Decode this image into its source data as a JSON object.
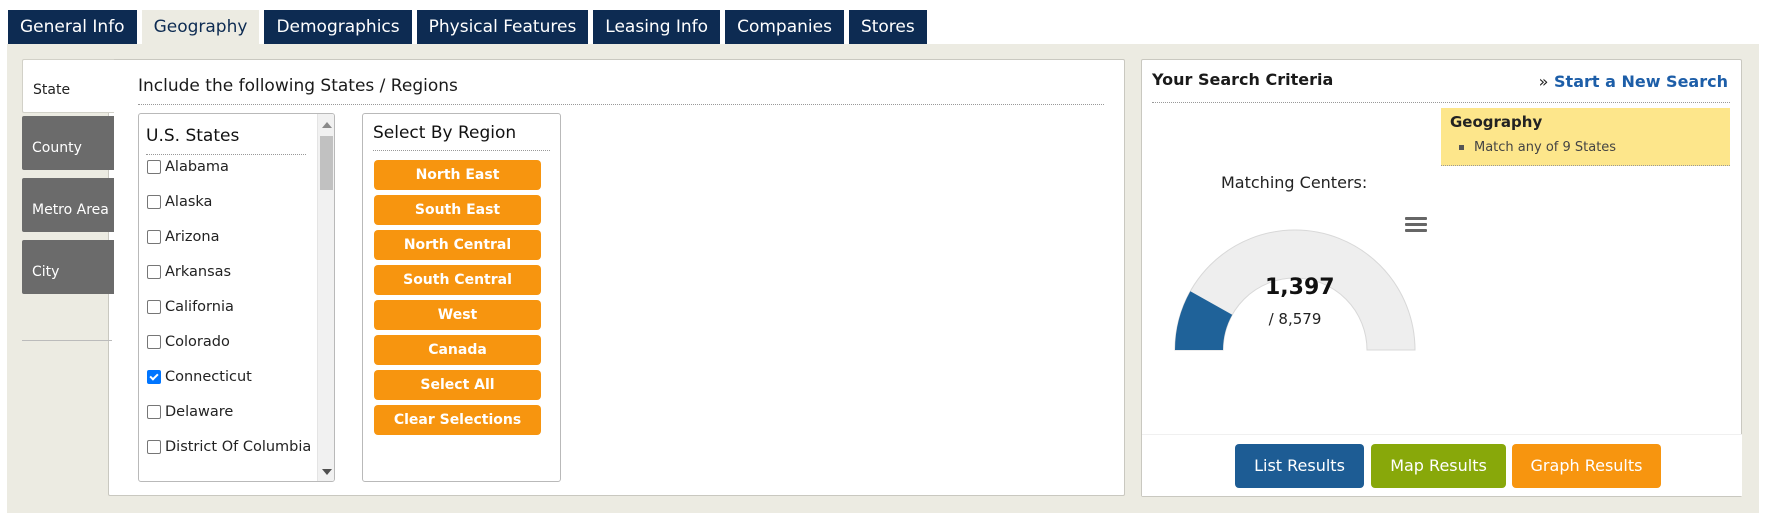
{
  "tabs": [
    "General Info",
    "Geography",
    "Demographics",
    "Physical Features",
    "Leasing Info",
    "Companies",
    "Stores"
  ],
  "active_tab": "Geography",
  "side_tabs": [
    "State",
    "County",
    "Metro Area",
    "City"
  ],
  "active_side_tab": "State",
  "section_title": "Include the following States / Regions",
  "states": {
    "heading": "U.S. States",
    "items": [
      {
        "label": "Alabama",
        "checked": false
      },
      {
        "label": "Alaska",
        "checked": false
      },
      {
        "label": "Arizona",
        "checked": false
      },
      {
        "label": "Arkansas",
        "checked": false
      },
      {
        "label": "California",
        "checked": false
      },
      {
        "label": "Colorado",
        "checked": false
      },
      {
        "label": "Connecticut",
        "checked": true
      },
      {
        "label": "Delaware",
        "checked": false
      },
      {
        "label": "District Of Columbia",
        "checked": false
      }
    ]
  },
  "regions": {
    "heading": "Select By Region",
    "buttons": [
      "North East",
      "South East",
      "North Central",
      "South Central",
      "West",
      "Canada",
      "Select All",
      "Clear Selections"
    ]
  },
  "criteria": {
    "title": "Your Search Criteria",
    "new_search_prefix": "»",
    "new_search_label": "Start a New Search",
    "geography_title": "Geography",
    "geography_item": "Match any of 9 States"
  },
  "gauge": {
    "label": "Matching Centers:",
    "value_text": "1,397",
    "total_text": "/ 8,579",
    "value": 1397,
    "total": 8579,
    "fill_color": "#1f6299",
    "track_color": "#eeeeee"
  },
  "results": {
    "list_label": "List Results",
    "map_label": "Map Results",
    "graph_label": "Graph Results",
    "list_color": "#1d5c94",
    "map_color": "#88a80a",
    "graph_color": "#f7950f"
  },
  "colors": {
    "nav_tab": "#0d2b52",
    "region_button": "#f7950f",
    "highlight": "#fde68b",
    "link": "#1d5ea8"
  }
}
